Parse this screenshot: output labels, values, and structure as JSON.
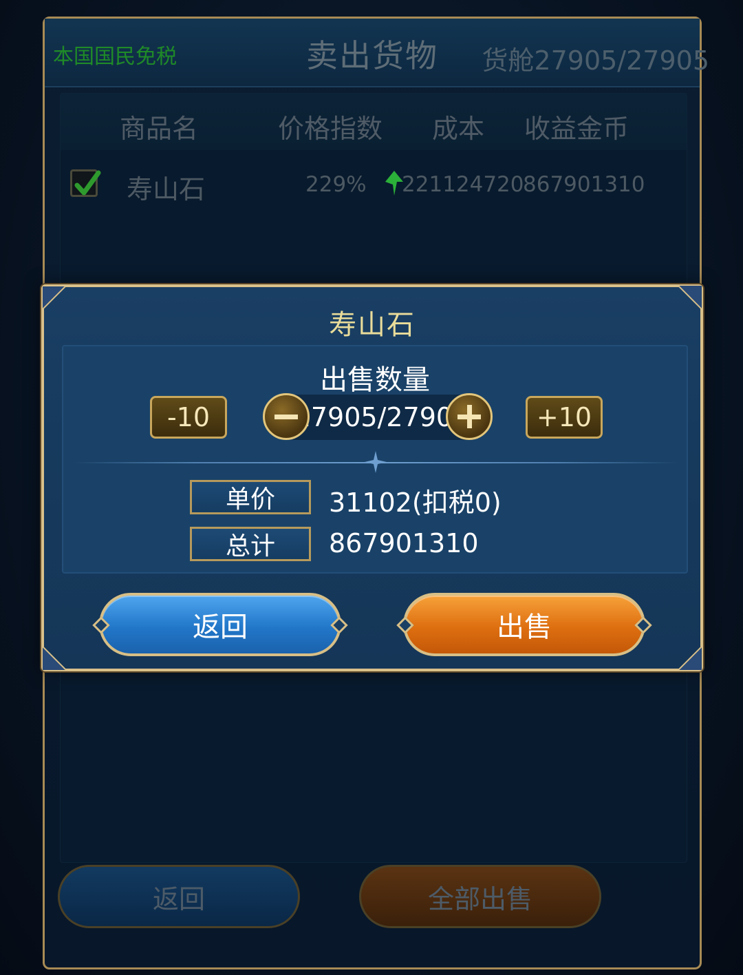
{
  "background": {
    "tax_note": "本国国民免税",
    "title": "卖出货物",
    "cargo": "货舱27905/27905",
    "table": {
      "headers": [
        "商品名",
        "价格指数",
        "成本",
        "收益金币"
      ],
      "rows": [
        {
          "checked": true,
          "name": "寿山石",
          "price_index": "229%",
          "cost": "221124720",
          "revenue": "867901310"
        }
      ]
    },
    "buttons": {
      "back": "返回",
      "sell_all": "全部出售"
    }
  },
  "modal": {
    "title": "寿山石",
    "quantity_label": "出售数量",
    "minus10": "-10",
    "plus10": "+10",
    "quantity_value": "27905/27905",
    "unit_price_label": "单价",
    "unit_price_value": "31102(扣税0)",
    "total_label": "总计",
    "total_value": "867901310",
    "back_label": "返回",
    "sell_label": "出售"
  },
  "colors": {
    "gold_border": "#d9c08a",
    "title_yellow": "#e9dc9a",
    "tax_green": "#1f8a28",
    "back_blue": "#2277c9",
    "sell_orange": "#de6f10",
    "check_green": "#3fbf3a",
    "arrow_green": "#2bb03a"
  }
}
